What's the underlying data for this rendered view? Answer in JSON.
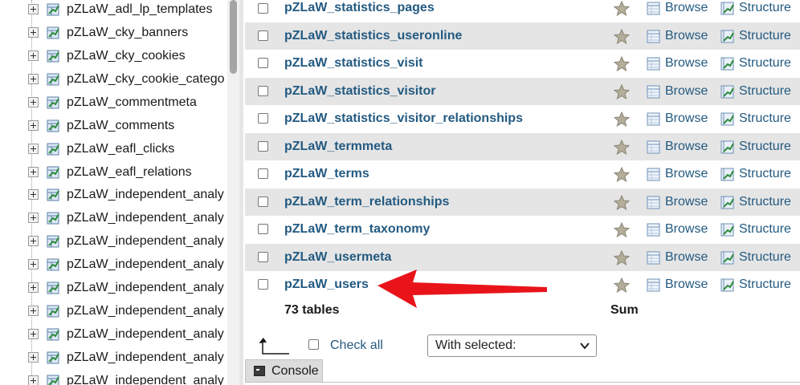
{
  "sidebar": {
    "items": [
      {
        "label": "pZLaW_adl_lp_templates"
      },
      {
        "label": "pZLaW_cky_banners"
      },
      {
        "label": "pZLaW_cky_cookies"
      },
      {
        "label": "pZLaW_cky_cookie_catego"
      },
      {
        "label": "pZLaW_commentmeta"
      },
      {
        "label": "pZLaW_comments"
      },
      {
        "label": "pZLaW_eafl_clicks"
      },
      {
        "label": "pZLaW_eafl_relations"
      },
      {
        "label": "pZLaW_independent_analy"
      },
      {
        "label": "pZLaW_independent_analy"
      },
      {
        "label": "pZLaW_independent_analy"
      },
      {
        "label": "pZLaW_independent_analy"
      },
      {
        "label": "pZLaW_independent_analy"
      },
      {
        "label": "pZLaW_independent_analy"
      },
      {
        "label": "pZLaW_independent_analy"
      },
      {
        "label": "pZLaW_independent_analy"
      },
      {
        "label": "pZLaW_independent_analy"
      }
    ]
  },
  "table": {
    "browse_label": "Browse",
    "structure_label": "Structure",
    "rows": [
      {
        "name": "pZLaW_statistics_pages"
      },
      {
        "name": "pZLaW_statistics_useronline"
      },
      {
        "name": "pZLaW_statistics_visit"
      },
      {
        "name": "pZLaW_statistics_visitor"
      },
      {
        "name": "pZLaW_statistics_visitor_relationships"
      },
      {
        "name": "pZLaW_termmeta"
      },
      {
        "name": "pZLaW_terms"
      },
      {
        "name": "pZLaW_term_relationships"
      },
      {
        "name": "pZLaW_term_taxonomy"
      },
      {
        "name": "pZLaW_usermeta"
      },
      {
        "name": "pZLaW_users"
      }
    ],
    "footer_count": "73 tables",
    "footer_sum": "Sum"
  },
  "bottom": {
    "check_all": "Check all",
    "with_selected": "With selected:"
  },
  "console": {
    "label": "Console"
  },
  "colors": {
    "link": "#235a81",
    "alt_row": "#e5e5e5",
    "arrow": "#e8141a"
  },
  "icons": {
    "star": "star-icon",
    "browse": "browse-icon",
    "structure": "structure-icon",
    "table": "table-icon",
    "expand": "expand-plus-icon"
  }
}
